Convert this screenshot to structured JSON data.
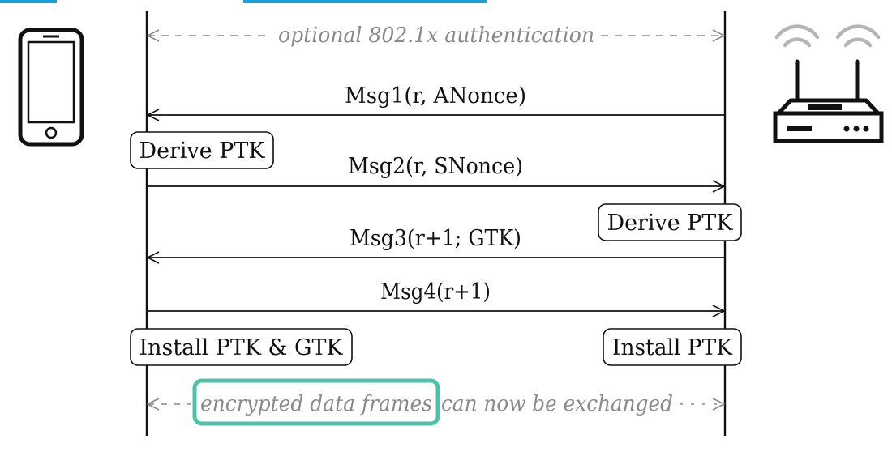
{
  "diagram": {
    "optional_auth": "optional 802.1x authentication",
    "messages": {
      "msg1": "Msg1(r, ANonce)",
      "msg2": "Msg2(r, SNonce)",
      "msg3": "Msg3(r+1; GTK)",
      "msg4": "Msg4(r+1)"
    },
    "client_boxes": {
      "derive_ptk": "Derive PTK",
      "install": "Install PTK & GTK"
    },
    "ap_boxes": {
      "derive_ptk": "Derive PTK",
      "install": "Install PTK"
    },
    "footer": {
      "highlight": "encrypted data frames",
      "rest": "can now be exchanged"
    },
    "colors": {
      "line": "#111111",
      "dashed": "#8a8a8a",
      "highlight": "#4fc1a7",
      "title_fragment": "#1aa0d6"
    },
    "icons": {
      "client": "smartphone-icon",
      "access_point": "wifi-router-icon"
    }
  }
}
